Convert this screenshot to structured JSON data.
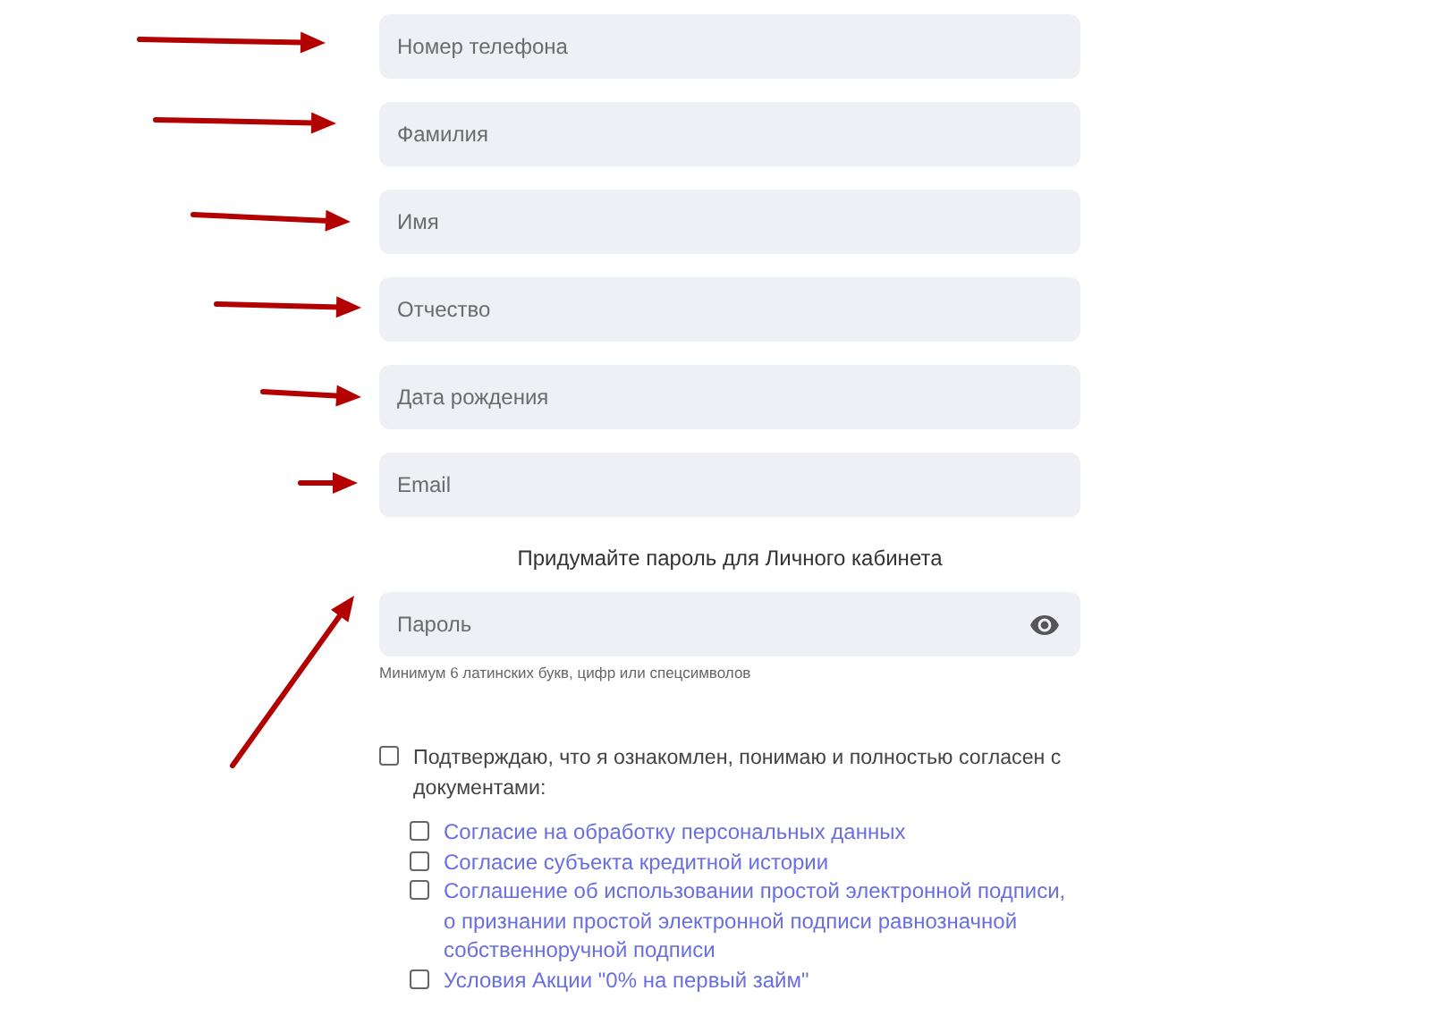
{
  "fields": [
    {
      "placeholder": "Номер телефона"
    },
    {
      "placeholder": "Фамилия"
    },
    {
      "placeholder": "Имя"
    },
    {
      "placeholder": "Отчество"
    },
    {
      "placeholder": "Дата рождения"
    },
    {
      "placeholder": "Email"
    }
  ],
  "password": {
    "heading": "Придумайте пароль для Личного кабинета",
    "placeholder": "Пароль",
    "hint": "Минимум 6 латинских букв, цифр или спецсимволов"
  },
  "consent": {
    "label": "Подтверждаю, что я ознакомлен, понимаю и полностью согласен с документами:",
    "checked": false,
    "documents": [
      {
        "label": "Согласие на обработку персональных данных",
        "checked": false
      },
      {
        "label": "Согласие субъекта кредитной истории",
        "checked": false
      },
      {
        "label": "Соглашение об использовании простой электронной подписи, о признании простой электронной подписи равнозначной собственноручной подписи",
        "checked": false
      },
      {
        "label": "Условия Акции \"0% на первый займ\"",
        "checked": false
      }
    ]
  }
}
